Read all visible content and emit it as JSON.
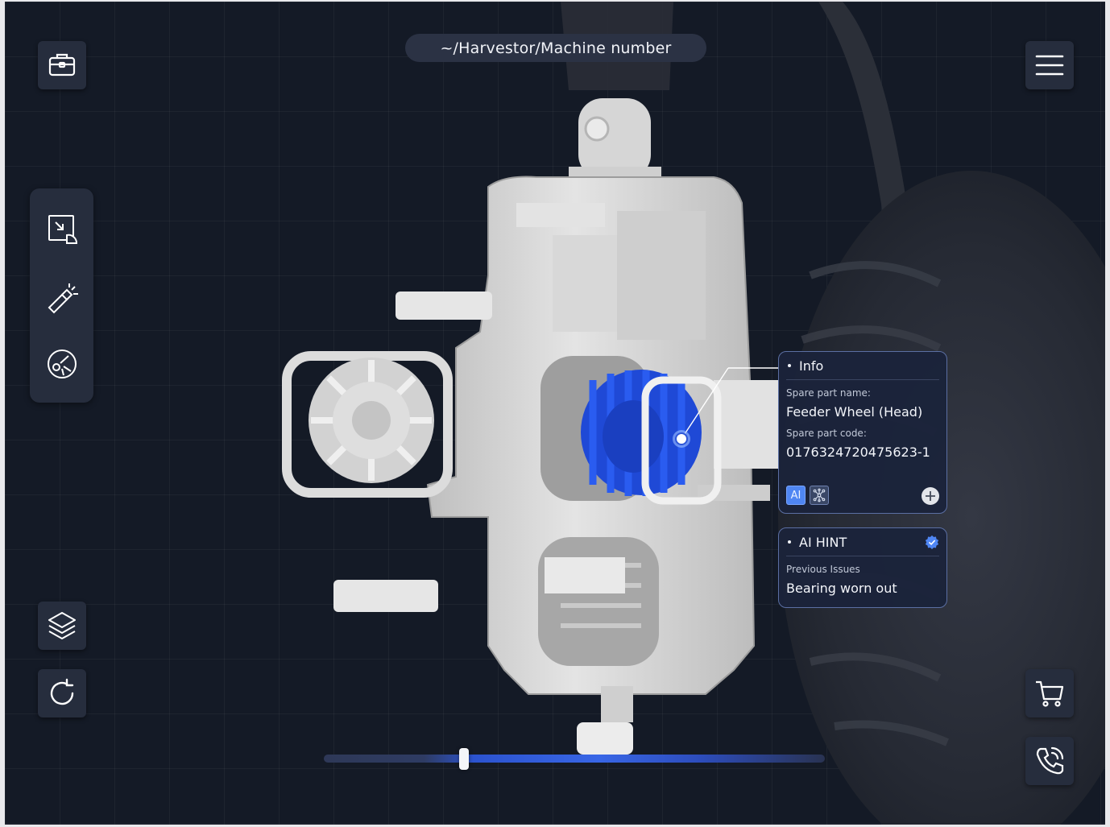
{
  "breadcrumb": {
    "path": "~/Harvestor/Machine number"
  },
  "toolbar": {
    "toolbox_icon": "briefcase-icon",
    "menu_icon": "hamburger-menu-icon",
    "cart_icon": "shopping-cart-icon",
    "phone_icon": "phone-call-icon",
    "layers_icon": "layers-icon",
    "reset_icon": "rotate-reset-icon"
  },
  "tool_rail": {
    "items": [
      {
        "icon": "shrink-view-icon"
      },
      {
        "icon": "flashlight-icon"
      },
      {
        "icon": "explode-view-icon"
      }
    ]
  },
  "info_panel": {
    "title": "Info",
    "spare_part_name_label": "Spare part name:",
    "spare_part_name": "Feeder Wheel (Head)",
    "spare_part_code_label": "Spare part code:",
    "spare_part_code": "0176324720475623-1",
    "ai_badge": "AI",
    "network_icon": "network-icon",
    "add_icon": "plus-circle-icon"
  },
  "ai_hint_panel": {
    "title": "AI HINT",
    "verified_icon": "verified-check-icon",
    "label": "Previous Issues",
    "value": "Bearing worn out"
  },
  "timeline": {
    "value": 0.28
  },
  "colors": {
    "background": "#141a26",
    "button": "#262d3d",
    "panel_border": "#5b6fa3",
    "highlight_part": "#1f49d6",
    "accent": "#3a6af0"
  }
}
